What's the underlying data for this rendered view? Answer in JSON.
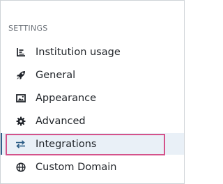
{
  "settings_menu": {
    "section_title": "SETTINGS",
    "items": [
      {
        "label": "Institution usage",
        "icon": "chart-bars-icon",
        "active": false
      },
      {
        "label": "General",
        "icon": "rocket-icon",
        "active": false
      },
      {
        "label": "Appearance",
        "icon": "image-icon",
        "active": false
      },
      {
        "label": "Advanced",
        "icon": "gear-icon",
        "active": false
      },
      {
        "label": "Integrations",
        "icon": "swap-arrows-icon",
        "active": true
      },
      {
        "label": "Custom Domain",
        "icon": "globe-icon",
        "active": false
      }
    ]
  },
  "colors": {
    "active_background": "#e9f0f7",
    "active_indicator": "#2f5f8a",
    "focus_outline": "#d4528a"
  }
}
